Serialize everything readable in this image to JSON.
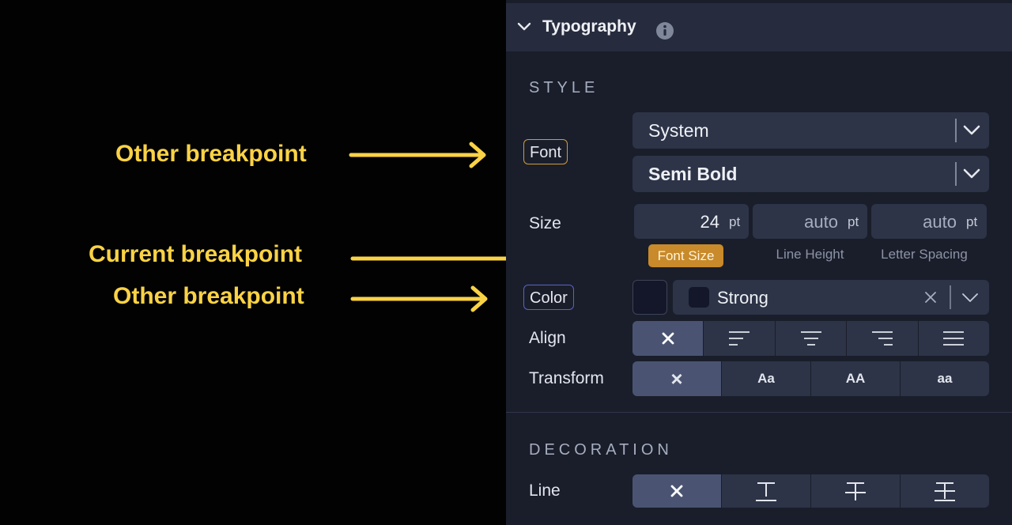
{
  "annotations": {
    "other_1": "Other breakpoint",
    "current": "Current breakpoint",
    "other_2": "Other breakpoint"
  },
  "panel": {
    "header": {
      "title": "Typography",
      "collapse_icon": "chevron-down-icon",
      "info_icon": "info-icon"
    },
    "style_section": {
      "title": "STYLE",
      "font": {
        "label": "Font",
        "family_value": "System",
        "weight_value": "Semi Bold"
      },
      "size": {
        "label": "Size",
        "font_size": {
          "value": "24",
          "unit": "pt",
          "caption": "Font Size"
        },
        "line_height": {
          "value": "auto",
          "unit": "pt",
          "caption": "Line Height"
        },
        "letter_spacing": {
          "value": "auto",
          "unit": "pt",
          "caption": "Letter Spacing"
        }
      },
      "color": {
        "label": "Color",
        "swatch_color": "#14172a",
        "value": "Strong"
      },
      "align": {
        "label": "Align",
        "options": [
          "none",
          "left",
          "center",
          "right",
          "justify"
        ],
        "selected": "none"
      },
      "transform": {
        "label": "Transform",
        "options": [
          "×",
          "Aa",
          "AA",
          "aa"
        ],
        "selected": "×"
      }
    },
    "decoration_section": {
      "title": "DECORATION",
      "line": {
        "label": "Line",
        "options": [
          "none",
          "underline",
          "strikethrough",
          "overline-strike"
        ],
        "selected": "none"
      }
    }
  },
  "colors": {
    "accent_annotation": "#fad245",
    "active_breakpoint": "#c88a2a",
    "other_breakpoint_font": "#d09a3e",
    "other_breakpoint_color": "#5b62c4",
    "panel_bg": "#1a1e2b"
  }
}
